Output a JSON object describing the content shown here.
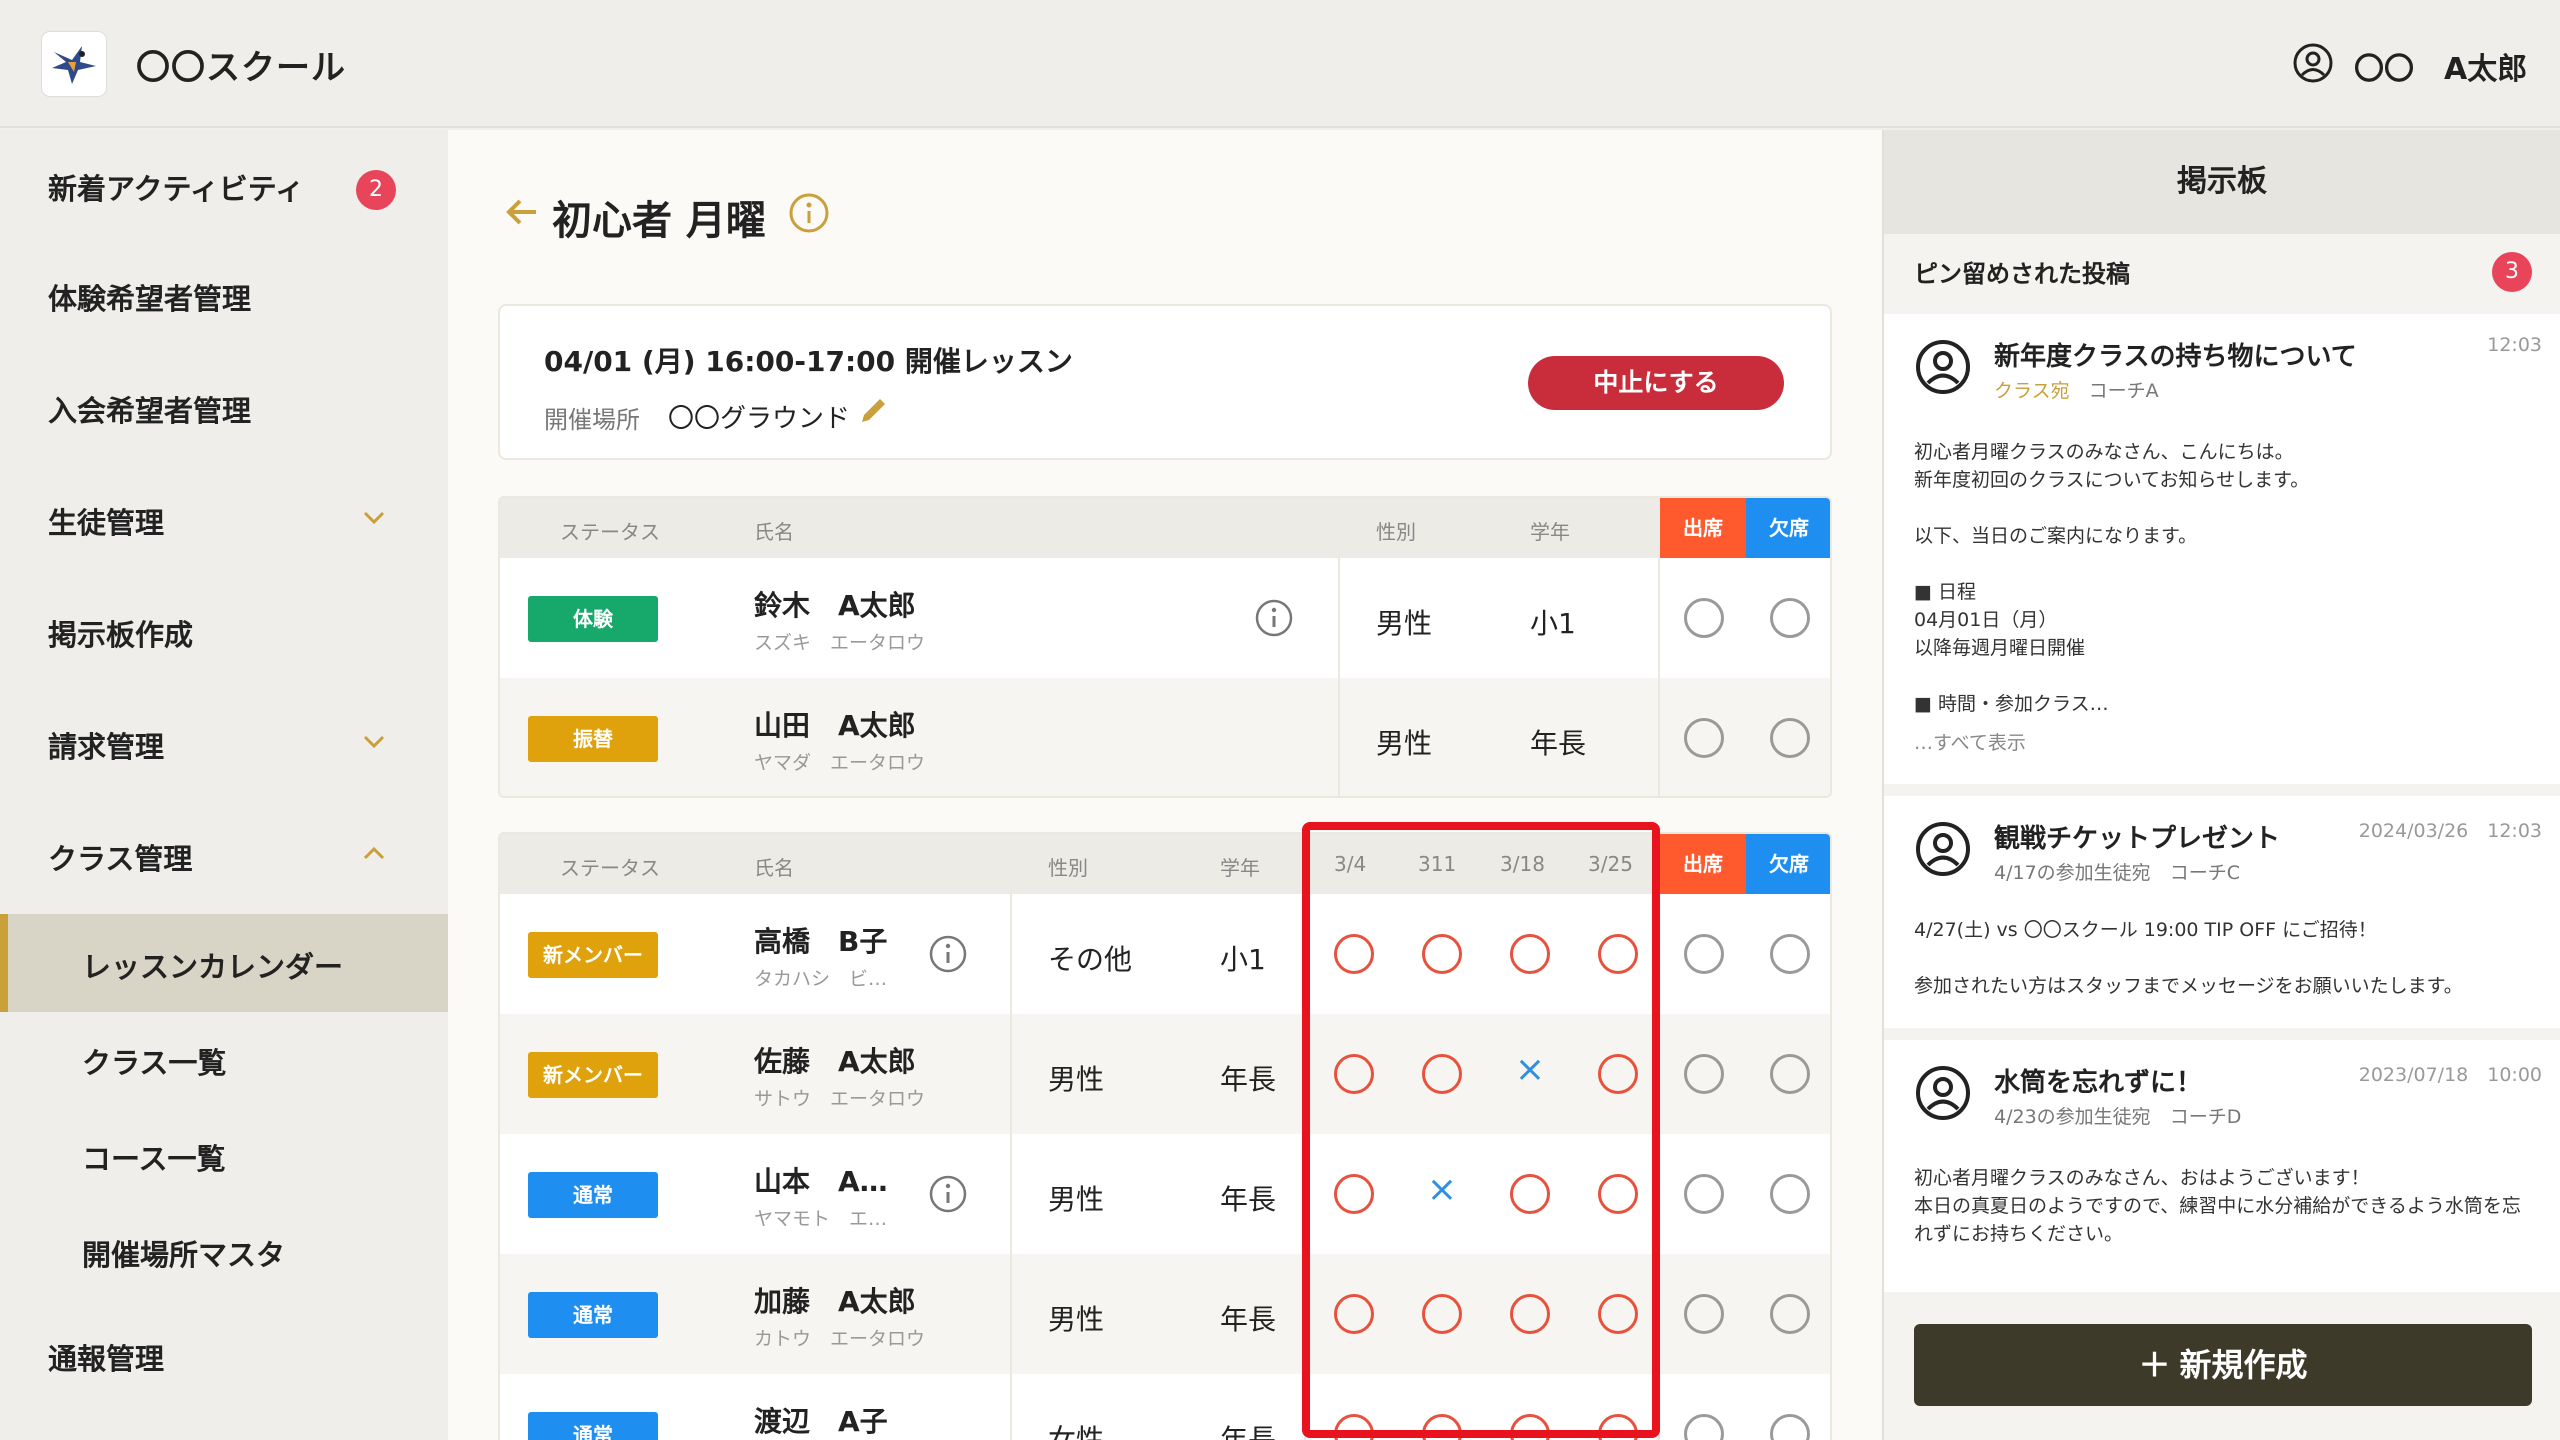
{
  "header": {
    "school_name": "〇〇スクール",
    "user_name": "〇〇　A太郎"
  },
  "sidebar": {
    "items": [
      {
        "label": "新着アクティビティ",
        "badge": "2"
      },
      {
        "label": "体験希望者管理"
      },
      {
        "label": "入会希望者管理"
      },
      {
        "label": "生徒管理"
      },
      {
        "label": "掲示板作成"
      },
      {
        "label": "請求管理"
      },
      {
        "label": "クラス管理"
      },
      {
        "label": "レッスンカレンダー"
      },
      {
        "label": "クラス一覧"
      },
      {
        "label": "コース一覧"
      },
      {
        "label": "開催場所マスタ"
      },
      {
        "label": "通報管理"
      }
    ]
  },
  "main": {
    "title": "初心者 月曜",
    "lesson": {
      "title": "04/01 (月) 16:00-17:00 開催レッスン",
      "location_label": "開催場所",
      "location": "〇〇グラウンド",
      "cancel_label": "中止にする"
    },
    "trial_table": {
      "headers": {
        "status": "ステータス",
        "name": "氏名",
        "gender": "性別",
        "grade": "学年",
        "present": "出席",
        "absent": "欠席"
      },
      "rows": [
        {
          "status": "体験",
          "name": "鈴木　A太郎",
          "kana": "スズキ　エータロウ",
          "gender": "男性",
          "grade": "小1"
        },
        {
          "status": "振替",
          "name": "山田　A太郎",
          "kana": "ヤマダ　エータロウ",
          "gender": "男性",
          "grade": "年長"
        }
      ]
    },
    "member_table": {
      "headers": {
        "status": "ステータス",
        "name": "氏名",
        "gender": "性別",
        "grade": "学年",
        "d1": "3/4",
        "d2": "311",
        "d3": "3/18",
        "d4": "3/25",
        "present": "出席",
        "absent": "欠席"
      },
      "rows": [
        {
          "status": "新メンバー",
          "name": "高橋　B子",
          "kana": "タカハシ　ビ…",
          "gender": "その他",
          "grade": "小1",
          "history": [
            "o",
            "o",
            "o",
            "o"
          ]
        },
        {
          "status": "新メンバー",
          "name": "佐藤　A太郎",
          "kana": "サトウ　エータロウ",
          "gender": "男性",
          "grade": "年長",
          "history": [
            "o",
            "o",
            "x",
            "o"
          ]
        },
        {
          "status": "通常",
          "name": "山本　A…",
          "kana": "ヤマモト　エ…",
          "gender": "男性",
          "grade": "年長",
          "history": [
            "o",
            "x",
            "o",
            "o"
          ]
        },
        {
          "status": "通常",
          "name": "加藤　A太郎",
          "kana": "カトウ　エータロウ",
          "gender": "男性",
          "grade": "年長",
          "history": [
            "o",
            "o",
            "o",
            "o"
          ]
        },
        {
          "status": "通常",
          "name": "渡辺　A子",
          "kana": "",
          "gender": "女性",
          "grade": "年長",
          "history": [
            "o",
            "o",
            "o",
            "o"
          ]
        }
      ]
    }
  },
  "board": {
    "title": "掲示板",
    "pinned_label": "ピン留めされた投稿",
    "pinned_count": "3",
    "posts": [
      {
        "title": "新年度クラスの持ち物について",
        "audience": "クラス宛",
        "author": "コーチA",
        "time": "12:03",
        "body": "初心者月曜クラスのみなさん、こんにちは。\n新年度初回のクラスについてお知らせします。\n\n以下、当日のご案内になります。\n\n■ 日程\n04月01日（月）\n以降毎週月曜日開催\n\n■ 時間・参加クラス…",
        "more": "…すべて表示"
      },
      {
        "title": "観戦チケットプレゼント",
        "audience": "4/17の参加生徒宛",
        "author": "コーチC",
        "time": "2024/03/26　12:03",
        "body": "4/27(土) vs 〇〇スクール 19:00 TIP OFF にご招待！\n\n参加されたい方はスタッフまでメッセージをお願いいたします。"
      },
      {
        "title": "水筒を忘れずに！",
        "audience": "4/23の参加生徒宛",
        "author": "コーチD",
        "time": "2023/07/18　10:00",
        "body": "初心者月曜クラスのみなさん、おはようございます！\n本日の真夏日のようですので、練習中に水分補給ができるよう水筒を忘れずにお持ちください。"
      }
    ],
    "new_button": "新規作成"
  },
  "colors": {
    "accent_gold": "#c9a03a",
    "cancel_red": "#c92d3b",
    "present_orange": "#ff5a2e",
    "absent_blue": "#1e8ff0",
    "status_trial": "#17a86b",
    "status_transfer": "#e0a20c",
    "status_new": "#e0a20c",
    "status_normal": "#1e8ff0",
    "badge_pink": "#e8445a",
    "highlight_red": "#e8131e"
  }
}
